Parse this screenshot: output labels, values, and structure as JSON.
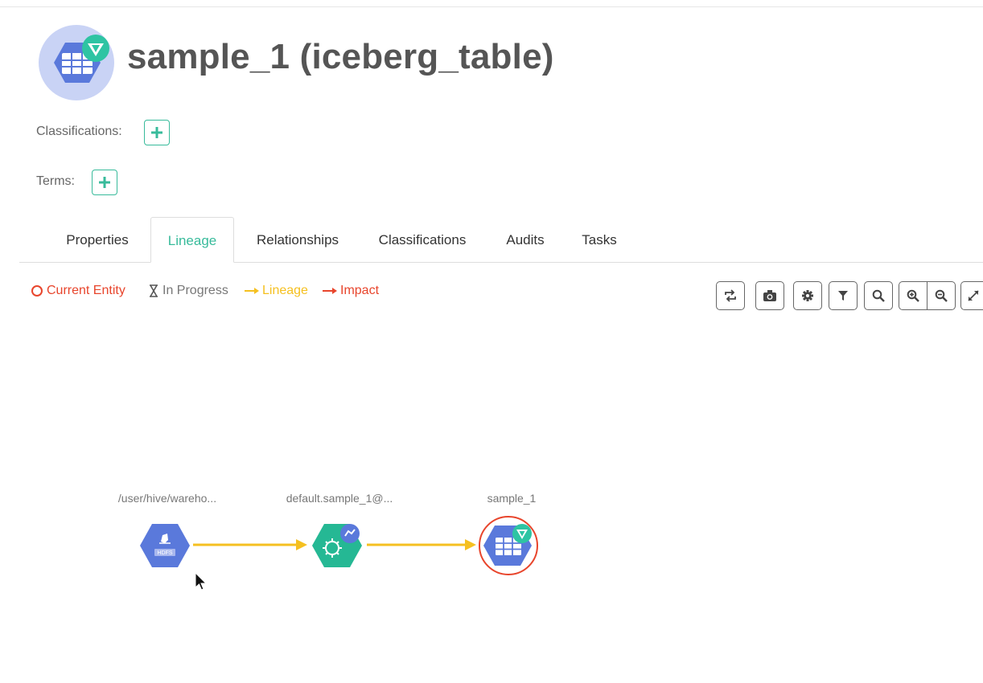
{
  "header": {
    "title": "sample_1 (iceberg_table)"
  },
  "classifications": {
    "label": "Classifications:",
    "add_symbol": "+"
  },
  "terms": {
    "label": "Terms:",
    "add_symbol": "+"
  },
  "tabs": [
    {
      "label": "Properties"
    },
    {
      "label": "Lineage",
      "active": true
    },
    {
      "label": "Relationships"
    },
    {
      "label": "Classifications"
    },
    {
      "label": "Audits"
    },
    {
      "label": "Tasks"
    }
  ],
  "legend": {
    "current_entity": "Current Entity",
    "in_progress": "In Progress",
    "lineage": "Lineage",
    "impact": "Impact"
  },
  "toolbar": [
    {
      "icon": "refresh-icon"
    },
    {
      "icon": "camera-icon"
    },
    {
      "icon": "settings-icon"
    },
    {
      "icon": "filter-icon"
    },
    {
      "icon": "search-icon"
    },
    {
      "icon": "zoom-in-icon"
    },
    {
      "icon": "zoom-out-icon"
    },
    {
      "icon": "fullscreen-icon"
    }
  ],
  "lineage_graph": {
    "nodes": [
      {
        "label": "/user/hive/wareho...",
        "type": "hdfs_path",
        "icon_text": "HDFS"
      },
      {
        "label": "default.sample_1@...",
        "type": "process"
      },
      {
        "label": "sample_1",
        "type": "iceberg_table",
        "current": true
      }
    ],
    "edges": [
      {
        "from": 0,
        "to": 1
      },
      {
        "from": 1,
        "to": 2
      }
    ]
  },
  "colors": {
    "accent": "#38bb9b",
    "current_entity": "#e8452c",
    "lineage": "#f5c020",
    "impact": "#e8452c",
    "table_node": "#5a79db",
    "process_node": "#25b894"
  }
}
